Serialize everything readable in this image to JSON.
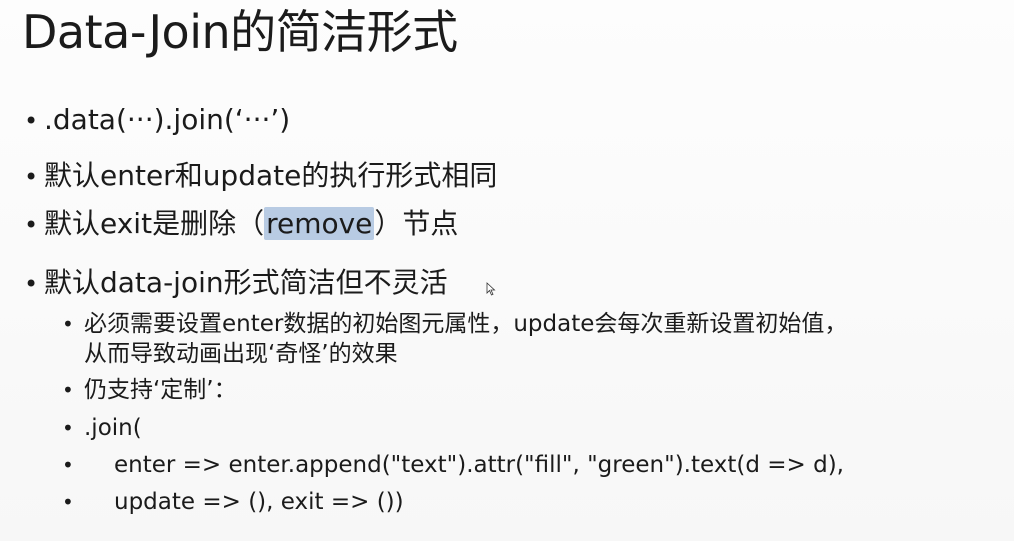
{
  "slide": {
    "title": "Data-Join的简洁形式",
    "bullets": [
      {
        "text": ".data(···).join(‘···’)"
      },
      {
        "text": "默认enter和update的执行形式相同"
      },
      {
        "pre": "默认exit是删除（",
        "highlight": "remove",
        "post": "）节点"
      },
      {
        "text": "默认data-join形式简洁但不灵活"
      }
    ],
    "sub_bullets": [
      {
        "line1": "必须需要设置enter数据的初始图元属性，update会每次重新设置初始值，",
        "line2": "从而导致动画出现‘奇怪’的效果"
      },
      {
        "text": "仍支持‘定制’："
      },
      {
        "text": ".join("
      },
      {
        "text": "enter => enter.append(\"text\").attr(\"fill\", \"green\").text(d => d),"
      },
      {
        "text": "update => (), exit => ())"
      }
    ],
    "highlight_color": "#b8cbe3"
  }
}
